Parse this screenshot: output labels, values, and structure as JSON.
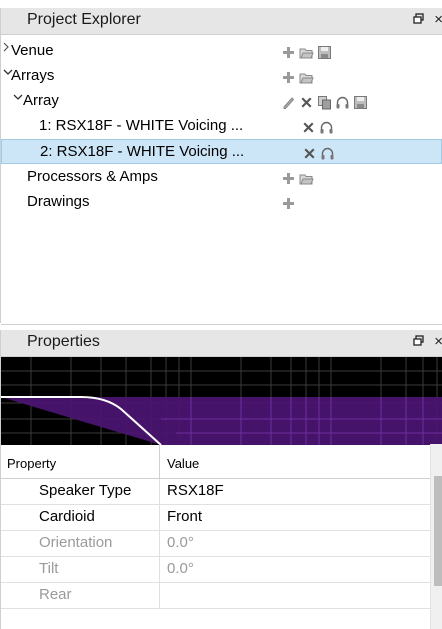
{
  "explorer": {
    "title": "Project Explorer",
    "pin_glyph": "и",
    "close_glyph": "×",
    "items": [
      {
        "label": "Venue",
        "chevron": ">",
        "icons": [
          "add-icon",
          "open-folder-icon",
          "save-icon"
        ]
      },
      {
        "label": "Arrays",
        "chevron": "v",
        "icons": [
          "add-icon",
          "open-folder-icon"
        ]
      },
      {
        "label": "Array",
        "chevron": "v",
        "icons": [
          "edit-icon",
          "delete-icon",
          "copy-icon",
          "headphones-icon",
          "save-icon"
        ]
      },
      {
        "label": "1: RSX18F - WHITE Voicing ...",
        "icons": [
          "delete-icon",
          "headphones-icon"
        ]
      },
      {
        "label": "2: RSX18F - WHITE Voicing ...",
        "icons": [
          "delete-icon",
          "headphones-icon"
        ],
        "selected": true
      },
      {
        "label": "Processors & Amps",
        "icons": [
          "add-icon",
          "open-folder-icon"
        ]
      },
      {
        "label": "Drawings",
        "icons": [
          "add-icon"
        ]
      }
    ]
  },
  "properties": {
    "title": "Properties",
    "pin_glyph": "и",
    "close_glyph": "×",
    "columns": [
      "Property",
      "Value"
    ],
    "rows": [
      {
        "key": "Speaker Type",
        "value": "RSX18F",
        "dim": false
      },
      {
        "key": "Cardioid",
        "value": "Front",
        "dim": false
      },
      {
        "key": "Orientation",
        "value": "0.0°",
        "dim": true
      },
      {
        "key": "Tilt",
        "value": "0.0°",
        "dim": true
      },
      {
        "key": "Rear",
        "value": "",
        "dim": true
      }
    ]
  },
  "colors": {
    "selection": "#cde6f7",
    "eq_fill": "#5b1a8a",
    "eq_curve": "#ffffff"
  }
}
